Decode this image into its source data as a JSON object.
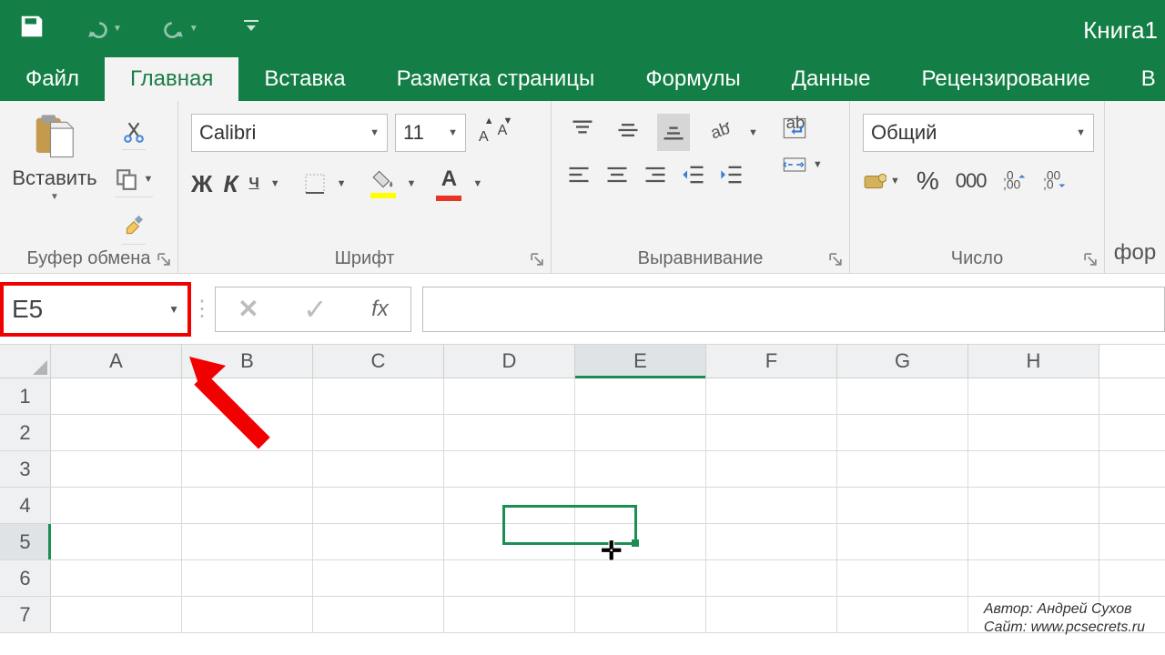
{
  "title": "Книга1",
  "tabs": {
    "file": "Файл",
    "home": "Главная",
    "insert": "Вставка",
    "layout": "Разметка страницы",
    "formulas": "Формулы",
    "data": "Данные",
    "review": "Рецензирование",
    "tail": "В"
  },
  "ribbon": {
    "clipboard": {
      "paste": "Вставить",
      "label": "Буфер обмена"
    },
    "font": {
      "name": "Calibri",
      "size": "11",
      "bold": "Ж",
      "italic": "К",
      "underline": "Ч",
      "label": "Шрифт",
      "bigA": "А",
      "smallA": "А",
      "colorA": "А"
    },
    "align": {
      "label": "Выравнивание"
    },
    "number": {
      "format": "Общий",
      "label": "Число",
      "percent": "%",
      "thousand": "000"
    },
    "tail": "фор"
  },
  "formula_bar": {
    "name_box": "E5",
    "fx": "fx"
  },
  "grid": {
    "columns": [
      "A",
      "B",
      "C",
      "D",
      "E",
      "F",
      "G",
      "H"
    ],
    "rows": [
      "1",
      "2",
      "3",
      "4",
      "5",
      "6",
      "7"
    ],
    "selected_col_index": 4,
    "selected_row_index": 4
  },
  "credits": {
    "l1": "Автор: Андрей Сухов",
    "l2": "Сайт: www.pcsecrets.ru"
  }
}
